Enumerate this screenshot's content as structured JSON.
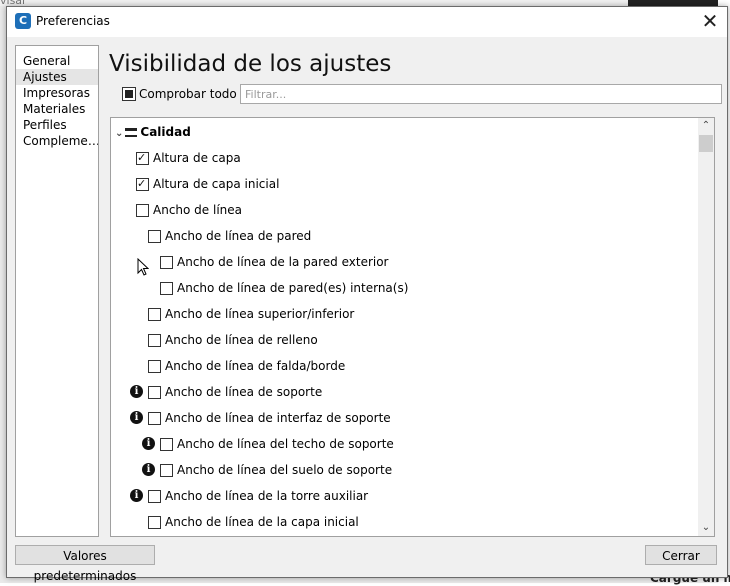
{
  "background": {
    "left_text": "visar",
    "bottom_text": "Cargue un m"
  },
  "dialog": {
    "title": "Preferencias",
    "close_symbol": "✕",
    "icon_letter": "C"
  },
  "nav": {
    "items": [
      {
        "label": "General",
        "selected": false
      },
      {
        "label": "Ajustes",
        "selected": true
      },
      {
        "label": "Impresoras",
        "selected": false
      },
      {
        "label": "Materiales",
        "selected": false
      },
      {
        "label": "Perfiles",
        "selected": false
      },
      {
        "label": "Compleme…",
        "selected": false
      }
    ]
  },
  "main": {
    "title": "Visibilidad de los ajustes",
    "check_all_label": "Comprobar todo",
    "check_all_state": "partial",
    "filter_placeholder": "Filtrar..."
  },
  "settings": {
    "category": "Calidad",
    "rows": [
      {
        "label": "Altura de capa",
        "checked": true,
        "level": 0,
        "info": false
      },
      {
        "label": "Altura de capa inicial",
        "checked": true,
        "level": 0,
        "info": false
      },
      {
        "label": "Ancho de línea",
        "checked": false,
        "level": 0,
        "info": false
      },
      {
        "label": "Ancho de línea de pared",
        "checked": false,
        "level": 1,
        "info": false
      },
      {
        "label": "Ancho de línea de la pared exterior",
        "checked": false,
        "level": 2,
        "info": false
      },
      {
        "label": "Ancho de línea de pared(es) interna(s)",
        "checked": false,
        "level": 2,
        "info": false
      },
      {
        "label": "Ancho de línea superior/inferior",
        "checked": false,
        "level": 1,
        "info": false
      },
      {
        "label": "Ancho de línea de relleno",
        "checked": false,
        "level": 1,
        "info": false
      },
      {
        "label": "Ancho de línea de falda/borde",
        "checked": false,
        "level": 1,
        "info": false
      },
      {
        "label": "Ancho de línea de soporte",
        "checked": false,
        "level": 1,
        "info": true
      },
      {
        "label": "Ancho de línea de interfaz de soporte",
        "checked": false,
        "level": 1,
        "info": true
      },
      {
        "label": "Ancho de línea del techo de soporte",
        "checked": false,
        "level": 2,
        "info": true
      },
      {
        "label": "Ancho de línea del suelo de soporte",
        "checked": false,
        "level": 2,
        "info": true
      },
      {
        "label": "Ancho de línea de la torre auxiliar",
        "checked": false,
        "level": 1,
        "info": true
      },
      {
        "label": "Ancho de línea de la capa inicial",
        "checked": false,
        "level": 1,
        "info": false
      }
    ]
  },
  "buttons": {
    "defaults_label": "Valores predeterminados",
    "close_label": "Cerrar"
  },
  "icons": {
    "app": "cura-logo-icon",
    "info": "info-icon",
    "category": "quality-icon",
    "expand": "chevron-down-icon"
  }
}
